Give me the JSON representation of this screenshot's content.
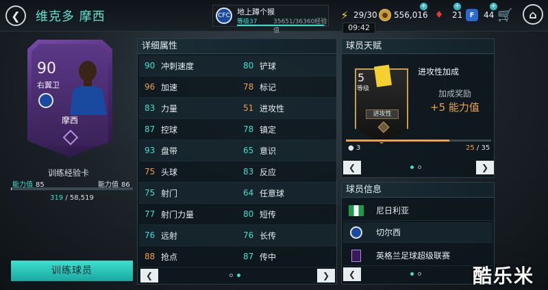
{
  "header": {
    "back_icon": "chevron-left-icon",
    "player_name": "维克多 摩西",
    "club": {
      "name": "地上蹲个猴",
      "level_label": "等级37",
      "xp": "35651/36360经验值",
      "xp_progress": 0.98
    },
    "energy": "29/30",
    "coins": "556,016",
    "gems": "21",
    "fifa_points_icon": "F",
    "fifa_points": "44",
    "timer": "09:42",
    "home_icon": "home-icon",
    "cart_icon": "cart-icon"
  },
  "player_card": {
    "rating": "90",
    "position": "右翼卫",
    "name": "摩西",
    "card_type": "训练经验卡",
    "rating_label_left": "能力值",
    "rating_current": "85",
    "rating_label_right": "能力值",
    "rating_next": "86",
    "progress_current": "319",
    "progress_total": "58,519",
    "progress_fraction": 0.005,
    "train_button": "训练球员"
  },
  "attributes": {
    "title": "详细属性",
    "rows": [
      [
        {
          "value": "90",
          "name": "冲刺速度",
          "tone": "green"
        },
        {
          "value": "80",
          "name": "铲球",
          "tone": "green"
        }
      ],
      [
        {
          "value": "96",
          "name": "加速",
          "tone": "orange"
        },
        {
          "value": "78",
          "name": "标记",
          "tone": "orange"
        }
      ],
      [
        {
          "value": "83",
          "name": "力量",
          "tone": "green"
        },
        {
          "value": "51",
          "name": "进攻性",
          "tone": "orange"
        }
      ],
      [
        {
          "value": "87",
          "name": "控球",
          "tone": "green"
        },
        {
          "value": "78",
          "name": "镇定",
          "tone": "green"
        }
      ],
      [
        {
          "value": "93",
          "name": "盘带",
          "tone": "green"
        },
        {
          "value": "65",
          "name": "意识",
          "tone": "green"
        }
      ],
      [
        {
          "value": "75",
          "name": "头球",
          "tone": "orange"
        },
        {
          "value": "83",
          "name": "反应",
          "tone": "green"
        }
      ],
      [
        {
          "value": "75",
          "name": "射门",
          "tone": "green"
        },
        {
          "value": "64",
          "name": "任意球",
          "tone": "green"
        }
      ],
      [
        {
          "value": "77",
          "name": "射门力量",
          "tone": "green"
        },
        {
          "value": "80",
          "name": "短传",
          "tone": "green"
        }
      ],
      [
        {
          "value": "76",
          "name": "远射",
          "tone": "green"
        },
        {
          "value": "76",
          "name": "长传",
          "tone": "green"
        }
      ],
      [
        {
          "value": "88",
          "name": "抢点",
          "tone": "orange"
        },
        {
          "value": "87",
          "name": "传中",
          "tone": "green"
        }
      ]
    ]
  },
  "talent": {
    "title": "球员天赋",
    "level": "5",
    "level_label": "等级",
    "tag": "进攻性",
    "name": "进攻性加成",
    "bonus_label": "加成奖励",
    "bonus_value": "+5 能力值",
    "min_count": "3",
    "count_current": "25",
    "count_total": "35",
    "progress_fraction": 0.71
  },
  "info": {
    "title": "球员信息",
    "nationality": "尼日利亚",
    "club": "切尔西",
    "league": "英格兰足球超级联赛"
  },
  "colors": {
    "accent": "#3ee0d0",
    "orange": "#f0a04a",
    "card_purple": "#5c3888"
  },
  "watermark": "酷乐米"
}
